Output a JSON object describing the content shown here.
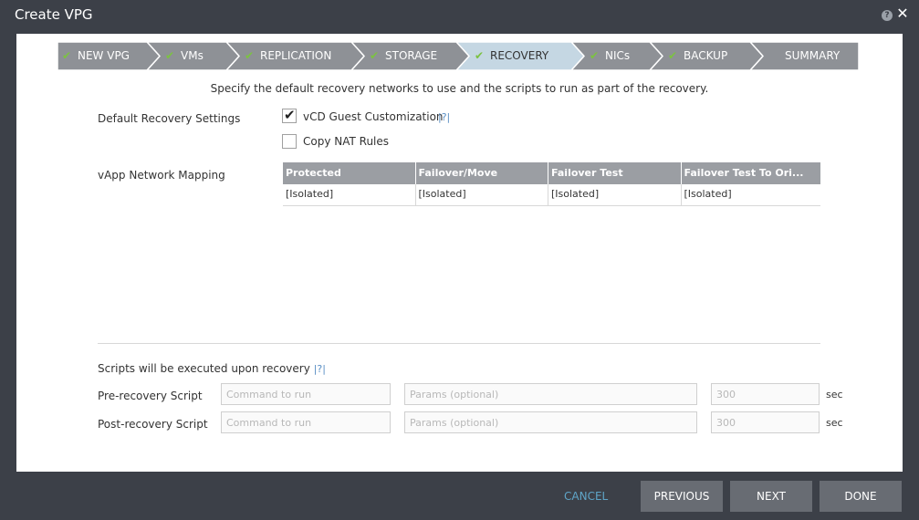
{
  "dialog": {
    "title": "Create VPG",
    "help_icon": "question-circle-icon",
    "close_icon": "close-icon"
  },
  "wizard": {
    "steps": [
      {
        "label": "NEW VPG",
        "completed": true,
        "active": false
      },
      {
        "label": "VMs",
        "completed": true,
        "active": false
      },
      {
        "label": "REPLICATION",
        "completed": true,
        "active": false
      },
      {
        "label": "STORAGE",
        "completed": true,
        "active": false
      },
      {
        "label": "RECOVERY",
        "completed": true,
        "active": true
      },
      {
        "label": "NICs",
        "completed": true,
        "active": false
      },
      {
        "label": "BACKUP",
        "completed": true,
        "active": false
      },
      {
        "label": "SUMMARY",
        "completed": false,
        "active": false
      }
    ],
    "check_glyph": "✔",
    "colors": {
      "inactive": "#8e9196",
      "active": "#c5d7e3",
      "check": "#7cc242"
    }
  },
  "subtitle": "Specify the default recovery networks to use and the scripts to run as part of the recovery.",
  "default_settings": {
    "label": "Default Recovery Settings",
    "vcd_guest": {
      "label": "vCD Guest Customization",
      "checked": true,
      "help": "|?|"
    },
    "copy_nat": {
      "label": "Copy NAT Rules",
      "checked": false
    }
  },
  "vapp": {
    "label": "vApp Network Mapping",
    "columns": [
      "Protected",
      "Failover/Move",
      "Failover Test",
      "Failover Test To Ori..."
    ],
    "rows": [
      [
        "[Isolated]",
        "[Isolated]",
        "[Isolated]",
        "[Isolated]"
      ]
    ]
  },
  "scripts": {
    "heading": "Scripts will be executed upon recovery",
    "help": "|?|",
    "pre": {
      "label": "Pre-recovery Script",
      "command_placeholder": "Command to run",
      "params_placeholder": "Params (optional)",
      "timeout": "300",
      "unit": "sec"
    },
    "post": {
      "label": "Post-recovery Script",
      "command_placeholder": "Command to run",
      "params_placeholder": "Params (optional)",
      "timeout": "300",
      "unit": "sec"
    }
  },
  "footer": {
    "cancel": "CANCEL",
    "previous": "PREVIOUS",
    "next": "NEXT",
    "done": "DONE"
  },
  "colors": {
    "frame": "#3c4048",
    "button": "#686c73",
    "cancel": "#5fa5c8",
    "grid_header": "#9b9ea3"
  }
}
